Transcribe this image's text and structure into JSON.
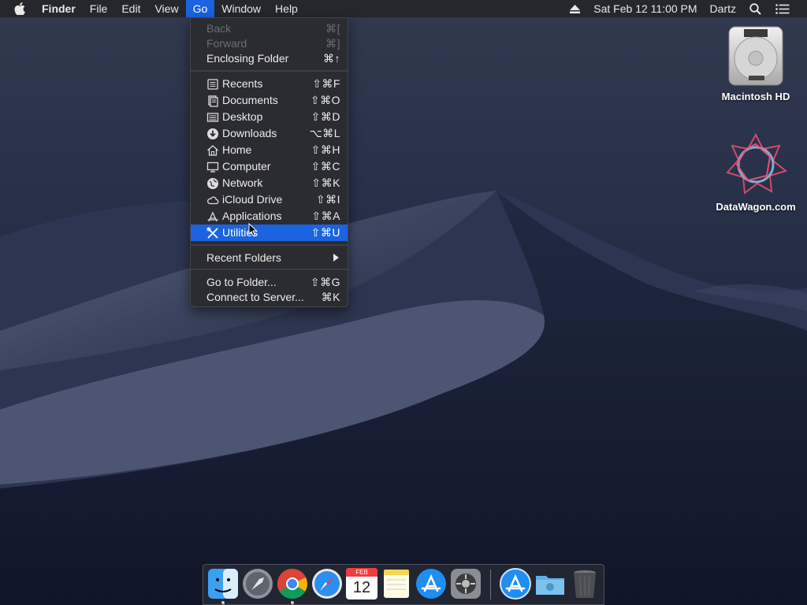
{
  "menubar": {
    "app_name": "Finder",
    "menus": [
      "File",
      "Edit",
      "View",
      "Go",
      "Window",
      "Help"
    ],
    "active_menu": "Go",
    "datetime": "Sat Feb 12  11:00 PM",
    "user": "Dartz",
    "icons": [
      "apple-icon",
      "eject-icon",
      "spotlight-icon",
      "notification-center-icon"
    ]
  },
  "go_menu": {
    "items": [
      {
        "label": "Back",
        "shortcut": "⌘[",
        "enabled": false
      },
      {
        "label": "Forward",
        "shortcut": "⌘]",
        "enabled": false
      },
      {
        "label": "Enclosing Folder",
        "shortcut": "⌘↑",
        "enabled": true
      },
      {
        "label": "Recents",
        "shortcut": "⇧⌘F",
        "icon": "recents-icon"
      },
      {
        "label": "Documents",
        "shortcut": "⇧⌘O",
        "icon": "documents-icon"
      },
      {
        "label": "Desktop",
        "shortcut": "⇧⌘D",
        "icon": "desktop-icon"
      },
      {
        "label": "Downloads",
        "shortcut": "⌥⌘L",
        "icon": "downloads-icon"
      },
      {
        "label": "Home",
        "shortcut": "⇧⌘H",
        "icon": "home-icon"
      },
      {
        "label": "Computer",
        "shortcut": "⇧⌘C",
        "icon": "computer-icon"
      },
      {
        "label": "Network",
        "shortcut": "⇧⌘K",
        "icon": "network-icon"
      },
      {
        "label": "iCloud Drive",
        "shortcut": "⇧⌘I",
        "icon": "icloud-icon"
      },
      {
        "label": "Applications",
        "shortcut": "⇧⌘A",
        "icon": "applications-icon"
      },
      {
        "label": "Utilities",
        "shortcut": "⇧⌘U",
        "icon": "utilities-icon",
        "selected": true
      },
      {
        "label": "Recent Folders",
        "submenu": true
      },
      {
        "label": "Go to Folder...",
        "shortcut": "⇧⌘G"
      },
      {
        "label": "Connect to Server...",
        "shortcut": "⌘K"
      }
    ]
  },
  "desktop_icons": [
    {
      "label": "Macintosh HD",
      "icon": "hard-drive-icon"
    },
    {
      "label": "DataWagon.com",
      "icon": "network-volume-icon"
    }
  ],
  "dock": {
    "apps": [
      "Finder",
      "Launchpad",
      "Google Chrome",
      "Safari",
      "Calendar",
      "Notes",
      "App Store",
      "System Preferences",
      "Applications",
      "Downloads",
      "Trash"
    ],
    "calendar": {
      "month": "FEB",
      "day": "12"
    },
    "running": [
      "Finder",
      "Google Chrome"
    ]
  },
  "colors": {
    "highlight": "#1b63df",
    "menubar": "#25272c",
    "menu_bg": "#2b2c31"
  }
}
